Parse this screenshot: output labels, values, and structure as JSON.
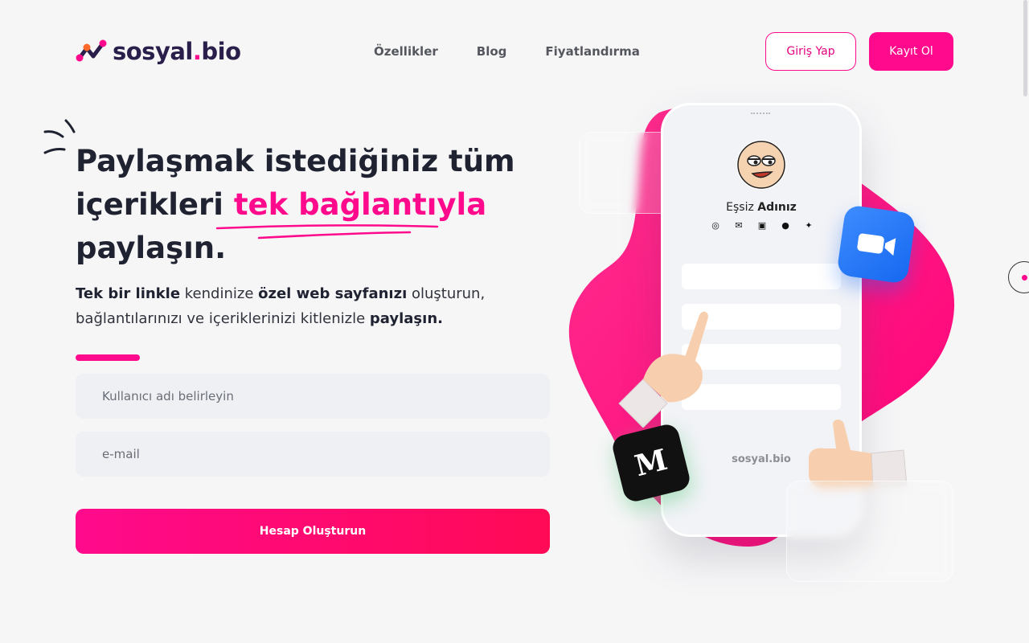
{
  "brand": {
    "name": "sosyal",
    "tld": "bio",
    "dot": ".",
    "accent": "#ff0a8c"
  },
  "nav": [
    {
      "label": "Özellikler"
    },
    {
      "label": "Blog"
    },
    {
      "label": "Fiyatlandırma"
    }
  ],
  "header": {
    "login_label": "Giriş Yap",
    "register_label": "Kayıt Ol"
  },
  "hero": {
    "title_part1": "Paylaşmak istediğiniz tüm içerikleri ",
    "title_highlight": "tek bağlantıyla",
    "title_part2": " paylaşın.",
    "sub_1": "Tek bir linkle",
    "sub_2": " kendinize ",
    "sub_3": "özel web sayfanızı",
    "sub_4": " oluşturun, bağlantılarınızı ve içeriklerinizi kitlenizle ",
    "sub_5": "paylaşın."
  },
  "form": {
    "username_placeholder": "Kullanıcı adı belirleyin",
    "email_placeholder": "e-mail",
    "submit_label": "Hesap Oluşturun"
  },
  "phone": {
    "name_prefix": "Eşsiz ",
    "name_bold": "Adınız",
    "brand": "sosyal.bio",
    "social_icons": [
      "instagram-icon",
      "mail-icon",
      "linkedin-icon",
      "facebook-icon",
      "twitter-icon"
    ]
  },
  "badges": {
    "medium": "M"
  }
}
